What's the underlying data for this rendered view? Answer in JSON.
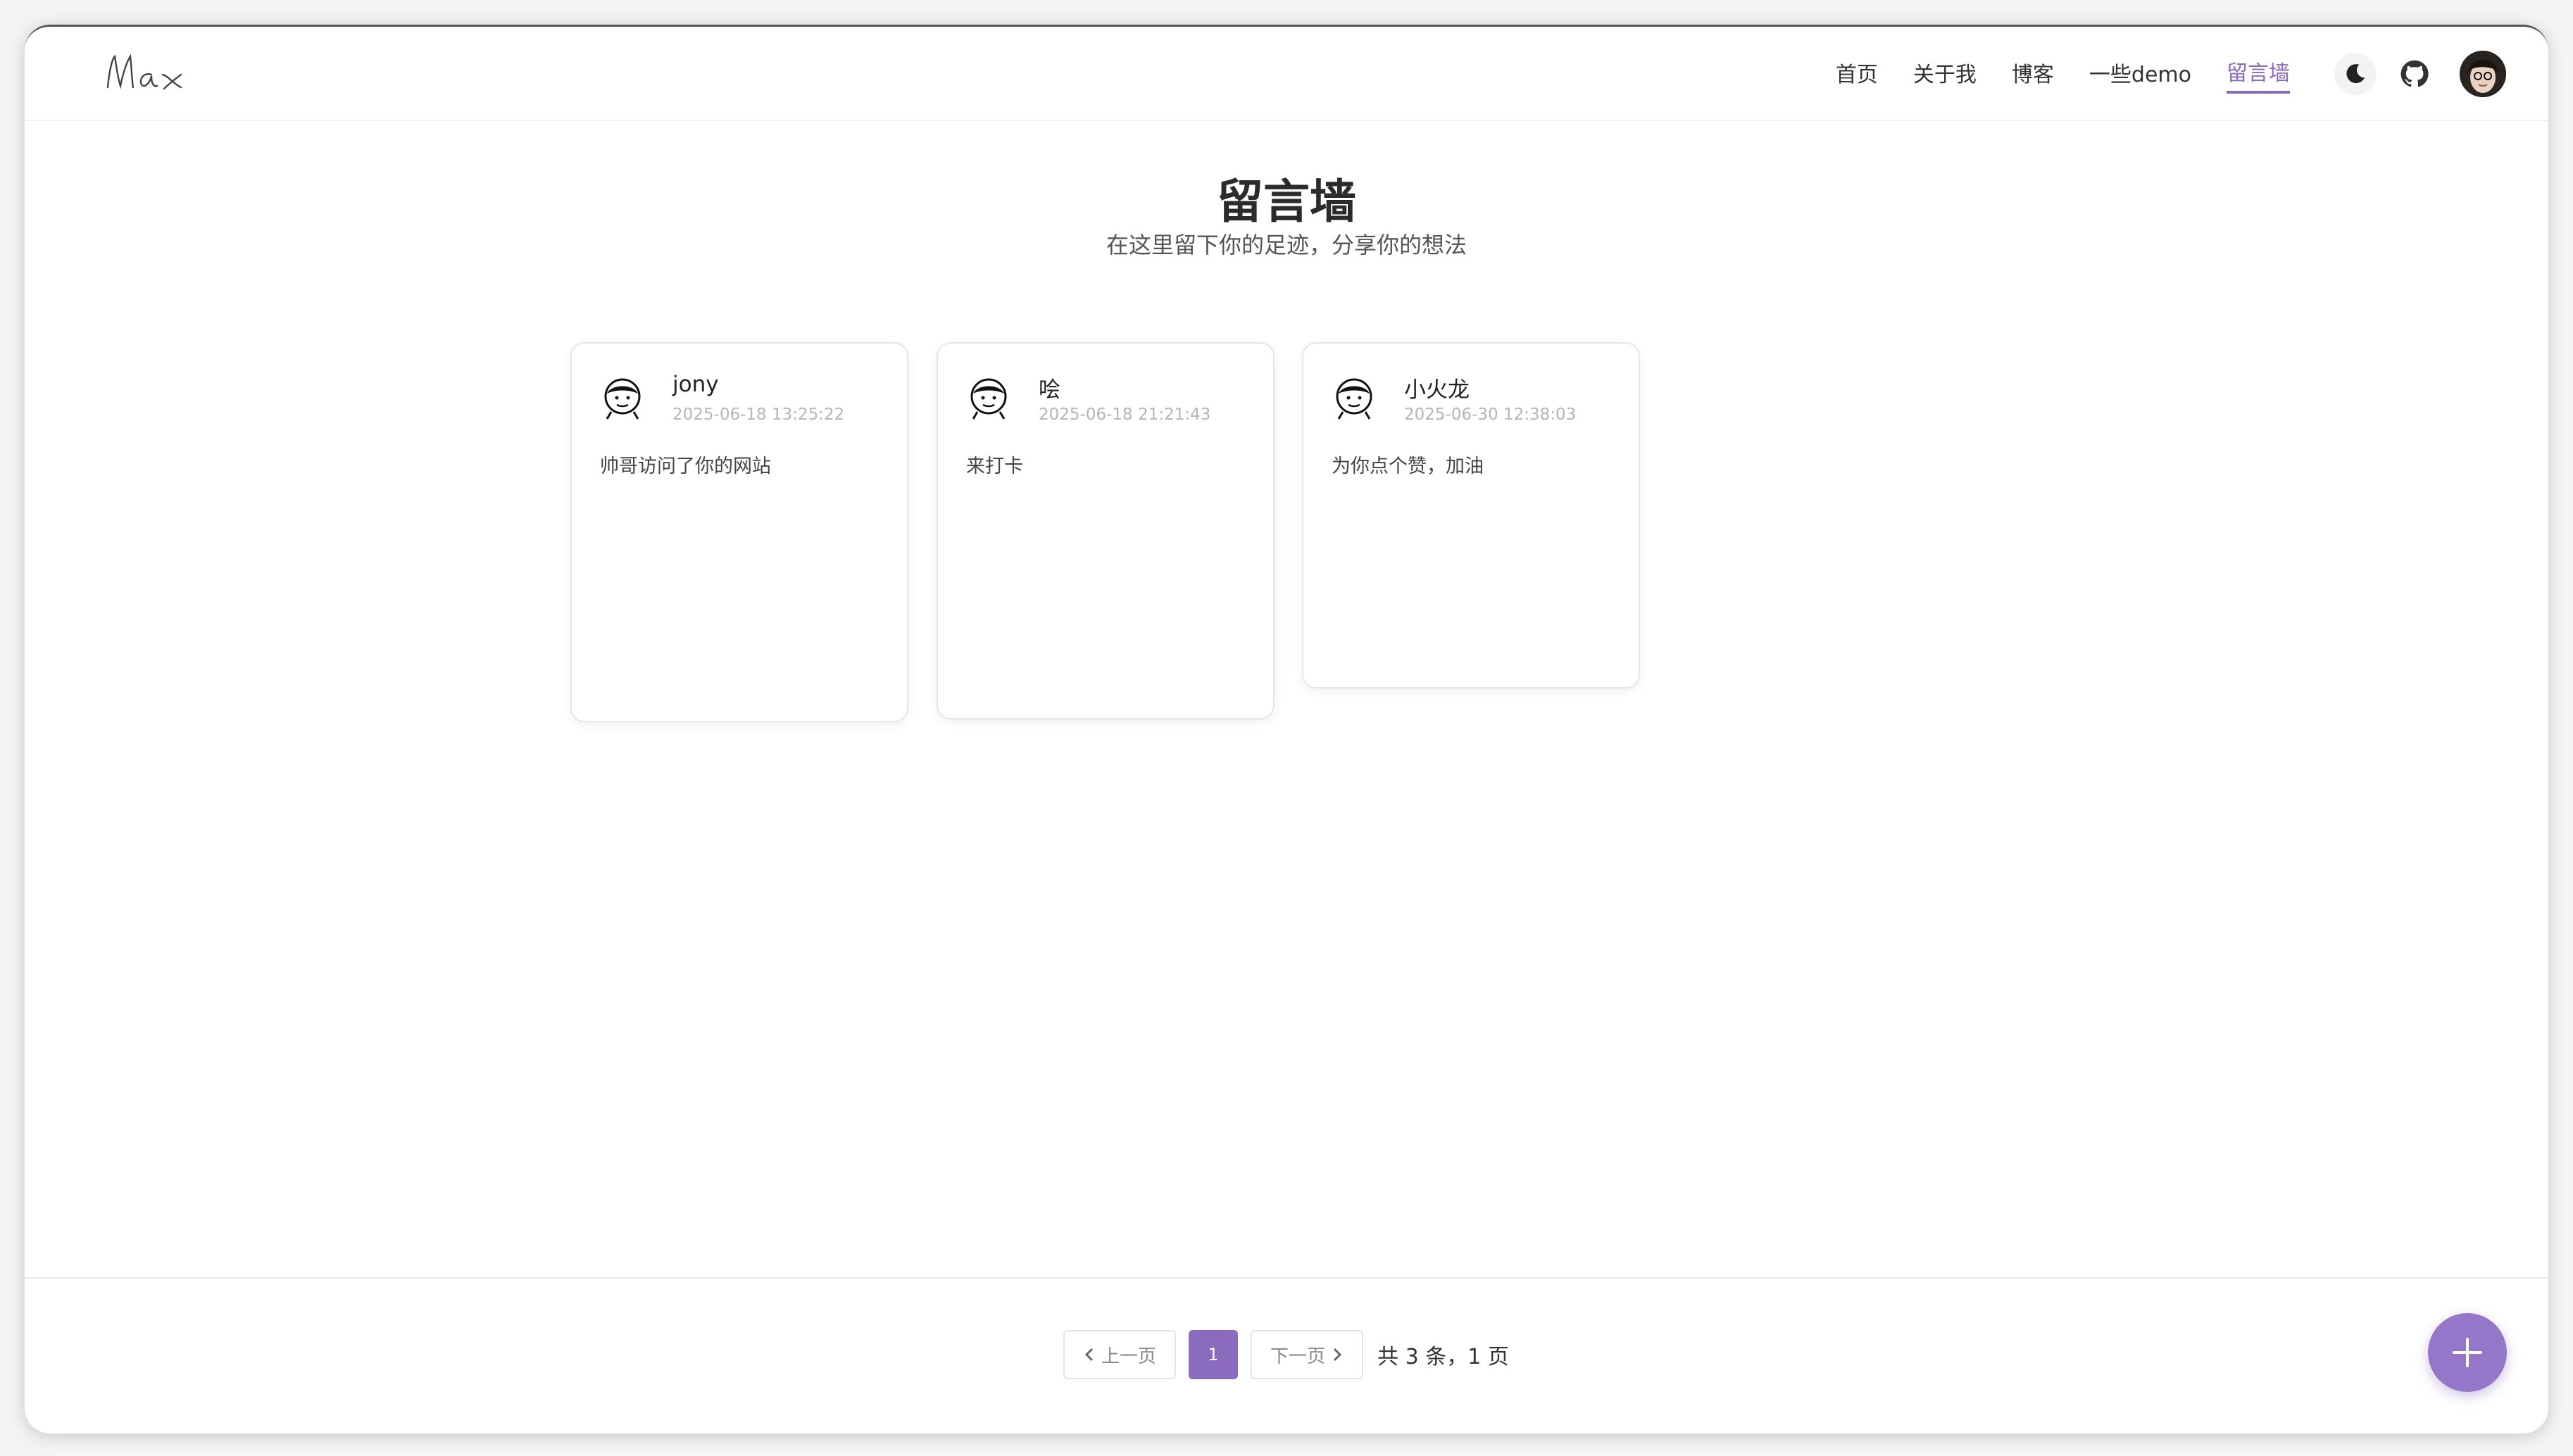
{
  "header": {
    "logo_text": "Max",
    "nav": [
      {
        "label": "首页"
      },
      {
        "label": "关于我"
      },
      {
        "label": "博客"
      },
      {
        "label": "一些demo"
      },
      {
        "label": "留言墙"
      }
    ],
    "active_nav": "留言墙",
    "icons": [
      "moon-icon",
      "github-icon",
      "user-avatar"
    ]
  },
  "main": {
    "title": "留言墙",
    "subtitle": "在这里留下你的足迹，分享你的想法",
    "messages": [
      {
        "name": "jony",
        "time": "2025-06-18 13:25:22",
        "text": "帅哥访问了你的网站"
      },
      {
        "name": "哙",
        "time": "2025-06-18 21:21:43",
        "text": "来打卡"
      },
      {
        "name": "小火龙",
        "time": "2025-06-30 12:38:03",
        "text": "为你点个赞，加油"
      }
    ]
  },
  "pagination": {
    "prev_label": "上一页",
    "current_page": "1",
    "next_label": "下一页",
    "total_label": "共 3 条，1 页"
  },
  "colors": {
    "accent": "#8a6bbd",
    "fab": "#9577c9"
  }
}
